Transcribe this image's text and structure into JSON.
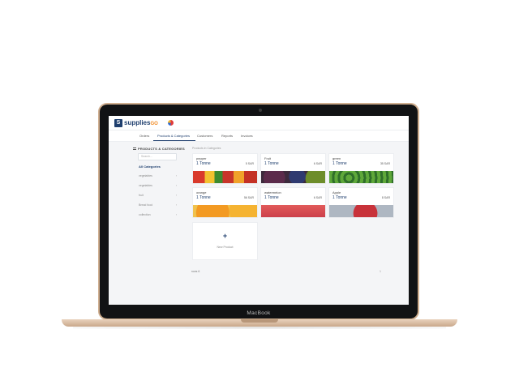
{
  "device": {
    "brand": "MacBook"
  },
  "app": {
    "logo_letter": "S",
    "name": "supplies",
    "name_suffix": "GO"
  },
  "nav": {
    "items": [
      {
        "label": "Orders"
      },
      {
        "label": "Products & Categories"
      },
      {
        "label": "Customers"
      },
      {
        "label": "Reports"
      },
      {
        "label": "Invoices"
      }
    ]
  },
  "sidebar": {
    "title": "PRODUCTS & CATEGORIES",
    "search_placeholder": "Search...",
    "all_label": "All Categories",
    "items": [
      {
        "label": "vegetables"
      },
      {
        "label": "vegetables"
      },
      {
        "label": "fruit"
      },
      {
        "label": "Bread food"
      },
      {
        "label": "collection"
      }
    ]
  },
  "main": {
    "section_label": "Products in Categories",
    "products": [
      {
        "name": "pepper",
        "qty": "1 Tonne",
        "price": "5 SAR",
        "image": "pepper"
      },
      {
        "name": "Fruit",
        "qty": "1 Tonne",
        "price": "6 SAR",
        "image": "fruit"
      },
      {
        "name": "green",
        "qty": "1 Tonne",
        "price": "35 SAR",
        "image": "greens"
      },
      {
        "name": "orange",
        "qty": "1 Tonne",
        "price": "56 SAR",
        "image": "orange"
      },
      {
        "name": "watermelon",
        "qty": "1 Tonne",
        "price": "6 SAR",
        "image": "watermelon"
      },
      {
        "name": "Apple",
        "qty": "1 Tonne",
        "price": "8 SAR",
        "image": "apple"
      }
    ],
    "new_product": {
      "icon": "+",
      "label": "New Product"
    },
    "pager": {
      "left": "rows 6",
      "right": "1"
    }
  },
  "icons": {
    "chevron": "›"
  },
  "colors": {
    "brand": "#1f3f6e",
    "accent": "#f08a24"
  }
}
